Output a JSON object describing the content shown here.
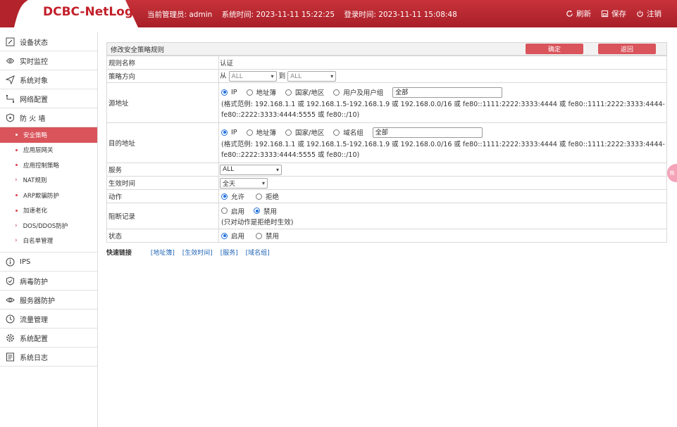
{
  "header": {
    "logo": "DCBC-NetLog",
    "admin_label": "当前管理员: admin",
    "system_time_label": "系统时间: 2023-11-11 15:22:25",
    "login_time_label": "登录时间: 2023-11-11 15:08:48",
    "refresh": "刷新",
    "save": "保存",
    "logout": "注销",
    "bg_color": "#b3232c"
  },
  "sidebar": {
    "items": [
      {
        "label": "设备状态",
        "icon": "edit-icon"
      },
      {
        "label": "实时监控",
        "icon": "location-icon"
      },
      {
        "label": "系统对象",
        "icon": "send-icon"
      },
      {
        "label": "网络配置",
        "icon": "network-icon"
      },
      {
        "label": "防 火 墙",
        "icon": "shield-icon"
      }
    ],
    "firewall_sub": [
      {
        "label": "安全策略",
        "active": true
      },
      {
        "label": "应用层网关"
      },
      {
        "label": "应用控制策略"
      },
      {
        "label": "NAT规则"
      },
      {
        "label": "ARP欺骗防护"
      },
      {
        "label": "加速老化"
      },
      {
        "label": "DOS/DDOS防护"
      },
      {
        "label": "白名单管理"
      }
    ],
    "items_after": [
      {
        "label": "IPS",
        "icon": "info-icon"
      },
      {
        "label": "病毒防护",
        "icon": "shield-check-icon"
      },
      {
        "label": "服务器防护",
        "icon": "eye-icon"
      },
      {
        "label": "流量管理",
        "icon": "clock-icon"
      },
      {
        "label": "系统配置",
        "icon": "gear-icon"
      },
      {
        "label": "系统日志",
        "icon": "log-icon"
      }
    ]
  },
  "form": {
    "title": "修改安全策略规则",
    "ok": "确定",
    "back": "返回",
    "rule_name_label": "规则名称",
    "rule_name_value": "认证",
    "direction_label": "策略方向",
    "from_label": "从",
    "to_label": "到",
    "from_value": "ALL",
    "to_value": "ALL",
    "src_label": "源地址",
    "src_options": [
      "IP",
      "地址簿",
      "国家/地区",
      "用户及用户组"
    ],
    "src_input": "全部",
    "src_hint_1": "(格式范例: 192.168.1.1 或 192.168.1.5-192.168.1.9 或 192.168.0.0/16 或 fe80::1111:2222:3333:4444 或 fe80::1111:2222:3333:4444-",
    "src_hint_2": "fe80::2222:3333:4444:5555 或 fe80::/10)",
    "dst_label": "目的地址",
    "dst_options": [
      "IP",
      "地址簿",
      "国家/地区",
      "域名组"
    ],
    "dst_input": "全部",
    "dst_hint_1": "(格式范例: 192.168.1.1 或 192.168.1.5-192.168.1.9 或 192.168.0.0/16 或 fe80::1111:2222:3333:4444 或 fe80::1111:2222:3333:4444-",
    "dst_hint_2": "fe80::2222:3333:4444:5555 或 fe80::/10)",
    "service_label": "服务",
    "service_value": "ALL",
    "time_label": "生效时间",
    "time_value": "全天",
    "action_label": "动作",
    "action_allow": "允许",
    "action_deny": "拒绝",
    "block_log_label": "阻断记录",
    "block_enable": "启用",
    "block_disable": "禁用",
    "block_hint": "(只对动作是拒绝时生效)",
    "status_label": "状态",
    "status_enable": "启用",
    "status_disable": "禁用"
  },
  "quick_links": {
    "title": "快速链接",
    "links": [
      "[地址簿]",
      "[生效时间]",
      "[服务]",
      "[域名组]"
    ]
  },
  "float_tab": "拖"
}
